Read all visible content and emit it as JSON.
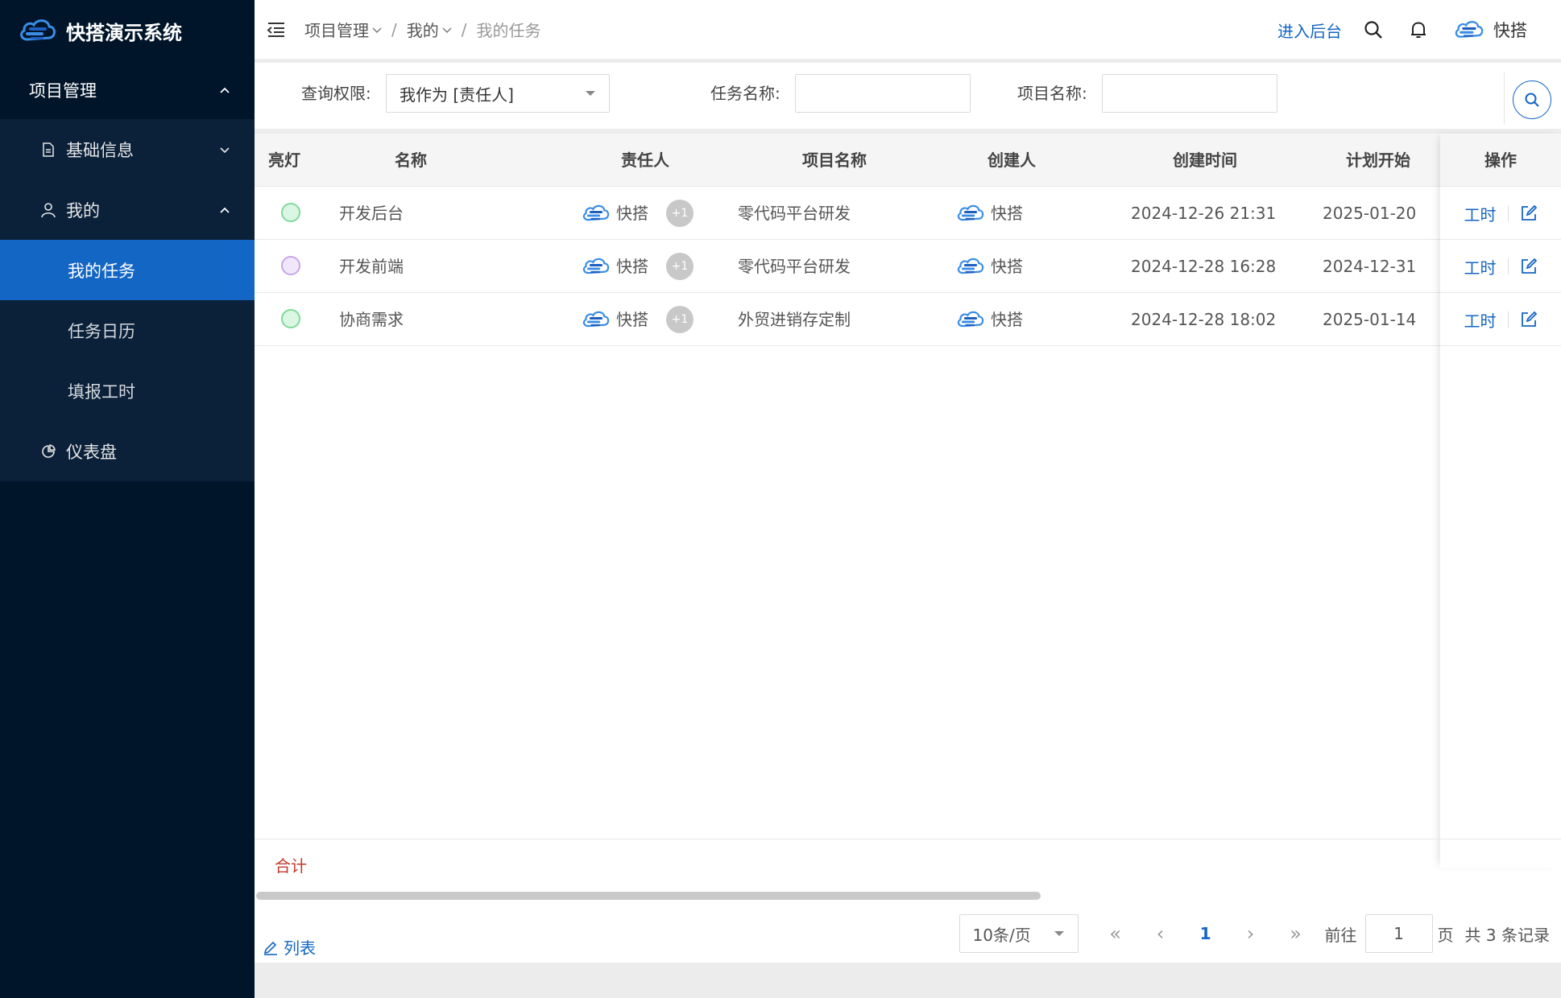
{
  "app": {
    "title": "快搭演示系统"
  },
  "sidebar": {
    "top_label": "项目管理",
    "groups": [
      {
        "label": "基础信息",
        "icon": "document-icon"
      },
      {
        "label": "我的",
        "icon": "user-icon"
      }
    ],
    "items": [
      {
        "label": "我的任务",
        "active": true
      },
      {
        "label": "任务日历"
      },
      {
        "label": "填报工时"
      }
    ],
    "dashboard": {
      "label": "仪表盘",
      "icon": "pie-chart-icon"
    }
  },
  "header": {
    "breadcrumb": [
      "项目管理",
      "我的",
      "我的任务"
    ],
    "admin_link": "进入后台",
    "user_name": "快搭"
  },
  "filter": {
    "scope_label": "查询权限:",
    "scope_value": "我作为 [责任人]",
    "task_name_label": "任务名称:",
    "project_name_label": "项目名称:"
  },
  "table": {
    "headers": {
      "light": "亮灯",
      "name": "名称",
      "owner": "责任人",
      "project": "项目名称",
      "creator": "创建人",
      "created": "创建时间",
      "plan_start": "计划开始",
      "ops": "操作"
    },
    "rows": [
      {
        "light_color": "#7fd99a",
        "name": "开发后台",
        "owner": "快搭",
        "extra": "+1",
        "project": "零代码平台研发",
        "creator": "快搭",
        "created": "2024-12-26 21:31",
        "plan_start": "2025-01-20",
        "op_label": "工时"
      },
      {
        "light_color": "#c8a6e6",
        "name": "开发前端",
        "owner": "快搭",
        "extra": "+1",
        "project": "零代码平台研发",
        "creator": "快搭",
        "created": "2024-12-28 16:28",
        "plan_start": "2024-12-31",
        "op_label": "工时"
      },
      {
        "light_color": "#7fd99a",
        "name": "协商需求",
        "owner": "快搭",
        "extra": "+1",
        "project": "外贸进销存定制",
        "creator": "快搭",
        "created": "2024-12-28 18:02",
        "plan_start": "2025-01-14",
        "op_label": "工时"
      }
    ],
    "summary_label": "合计"
  },
  "footer": {
    "list_label": "列表",
    "page_size": "10条/页",
    "current_page": "1",
    "goto_label": "前往",
    "goto_value": "1",
    "page_unit": "页",
    "total": "共 3 条记录"
  },
  "colors": {
    "sidebar_bg": "#001529",
    "accent": "#1466c4"
  }
}
